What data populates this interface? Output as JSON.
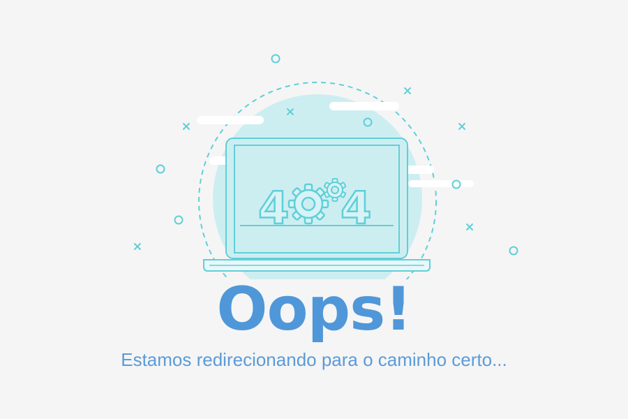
{
  "illustration": {
    "error_code": "404",
    "gear_icon": "gear-icon",
    "colors": {
      "outline": "#5fcfd8",
      "fill": "#cdeef1",
      "sparkle": "#5fcfd8"
    }
  },
  "headline": "Oops!",
  "message": "Estamos redirecionando para o caminho certo...",
  "colors": {
    "background": "#f5f5f5",
    "headline": "#4f97d9",
    "message": "#5b9bd8"
  }
}
